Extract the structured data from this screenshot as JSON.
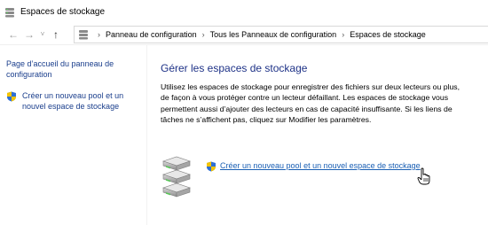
{
  "window": {
    "title": "Espaces de stockage",
    "icon": "storage-spaces-icon"
  },
  "nav": {
    "back_icon": "back-arrow-icon",
    "forward_icon": "forward-arrow-icon",
    "recent_icon": "chevron-down-icon",
    "up_icon": "up-arrow-icon",
    "breadcrumbs": [
      "Panneau de configuration",
      "Tous les Panneaux de configuration",
      "Espaces de stockage"
    ]
  },
  "sidebar": {
    "home_link": "Page d’accueil du panneau de configuration",
    "create_link": "Créer un nouveau pool et un nouvel espace de stockage"
  },
  "main": {
    "heading": "Gérer les espaces de stockage",
    "description": "Utilisez les espaces de stockage pour enregistrer des fichiers sur deux lecteurs ou plus, de façon à vous protéger contre un lecteur défaillant. Les espaces de stockage vous permettent aussi d’ajouter des lecteurs en cas de capacité insuffisante. Si les liens de tâches ne s’affichent pas, cliquez sur Modifier les paramètres.",
    "task_link": "Créer un nouveau pool et un nouvel espace de stockage"
  },
  "colors": {
    "link": "#1a5fb4",
    "heading": "#1e3287"
  }
}
